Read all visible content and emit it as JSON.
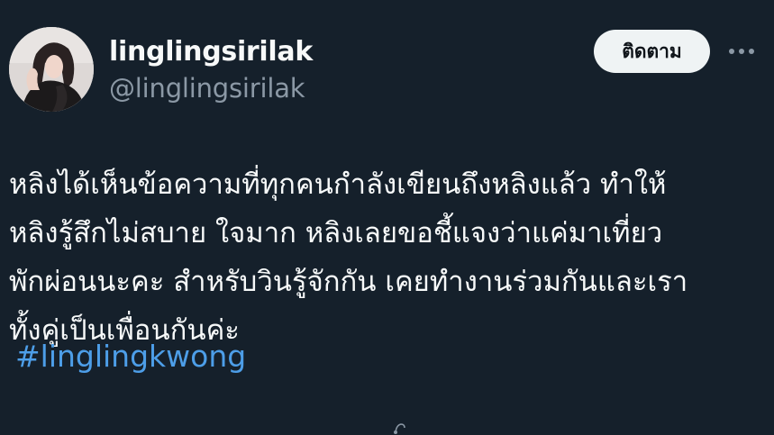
{
  "author": {
    "display_name": "linglingsirilak",
    "handle": "@linglingsirilak"
  },
  "actions": {
    "follow_label": "ติดตาม",
    "more_icon": "more-horizontal-icon"
  },
  "post": {
    "lines": [
      "หลิงได้เห็นข้อความที่ทุกคนกำลังเขียนถึงหลิงแล้ว ทำให้",
      "หลิงรู้สึกไม่สบาย ใจมาก หลิงเลยขอชี้แจงว่าแค่มาเที่ยว",
      "พักผ่อนนะคะ สำหรับวินรู้จักกัน เคยทำงานร่วมกันและเรา",
      "ทั้งคู่เป็นเพื่อนกันค่ะ"
    ],
    "hashtag": "#linglingkwong"
  },
  "colors": {
    "background": "#15202b",
    "text_primary": "#f7f9f9",
    "text_secondary": "#8b98a5",
    "link": "#4d9ee8",
    "button_bg": "#eff3f4"
  }
}
